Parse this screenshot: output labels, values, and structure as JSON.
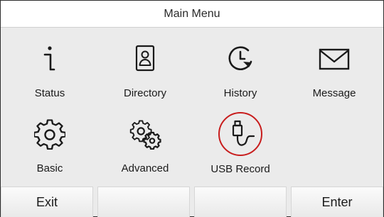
{
  "header": {
    "title": "Main Menu"
  },
  "menu": {
    "items": [
      {
        "label": "Status",
        "icon": "info-icon"
      },
      {
        "label": "Directory",
        "icon": "contact-card-icon"
      },
      {
        "label": "History",
        "icon": "history-clock-icon"
      },
      {
        "label": "Message",
        "icon": "envelope-icon"
      },
      {
        "label": "Basic",
        "icon": "gear-icon"
      },
      {
        "label": "Advanced",
        "icon": "gears-icon"
      },
      {
        "label": "USB Record",
        "icon": "usb-cable-icon",
        "selected": true
      }
    ]
  },
  "softkeys": [
    {
      "label": "Exit"
    },
    {
      "label": ""
    },
    {
      "label": ""
    },
    {
      "label": "Enter"
    }
  ],
  "colors": {
    "selection_ring": "#c81d1d",
    "background": "#ebebeb",
    "title_bar": "#ffffff"
  }
}
